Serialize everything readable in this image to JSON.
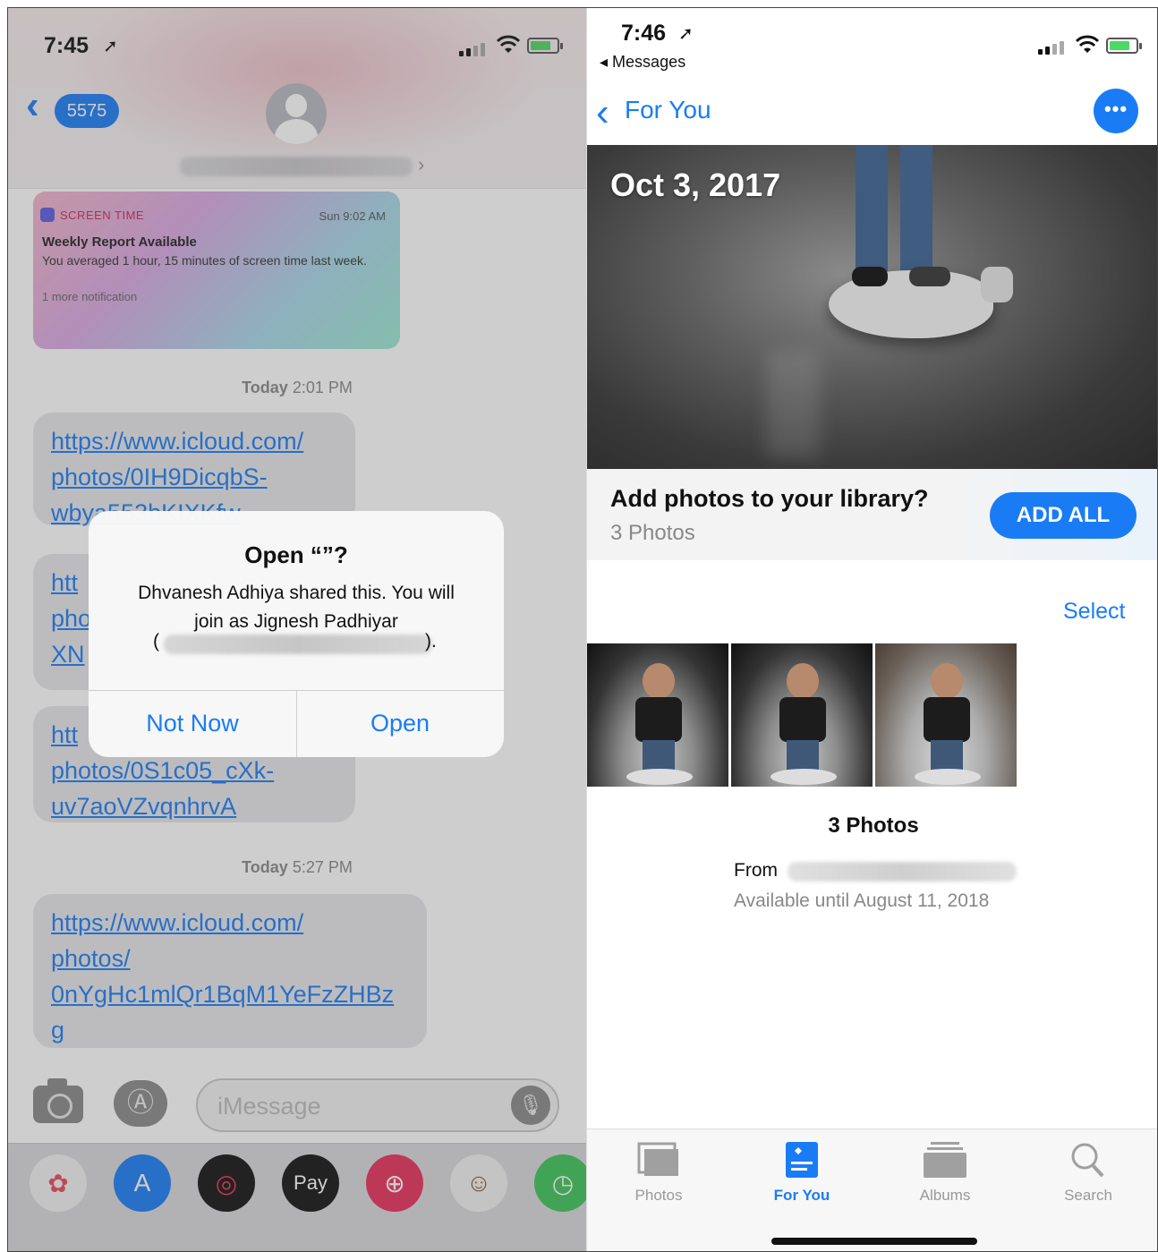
{
  "left": {
    "status_time": "7:45",
    "back_count": "5575",
    "notification": {
      "app": "SCREEN TIME",
      "time": "Sun 9:02 AM",
      "title": "Weekly Report Available",
      "body": "You averaged 1 hour, 15 minutes of screen time last week.",
      "more": "1 more notification"
    },
    "timestamp1_day": "Today",
    "timestamp1_time": "2:01 PM",
    "bubble1": [
      "https://www.icloud.com/",
      "photos/0IH9DicqbS-",
      "wbya553bKIXKfw"
    ],
    "bubble2": [
      "htt",
      "pho",
      "XN"
    ],
    "bubble3": [
      "htt",
      "photos/0S1c05_cXk-",
      "uv7aoVZvqnhrvA"
    ],
    "timestamp2_day": "Today",
    "timestamp2_time": "5:27 PM",
    "bubble4": [
      "https://www.icloud.com/",
      "photos/",
      "0nYgHc1mlQr1BqM1YeFzZHBz",
      "g"
    ],
    "alert": {
      "title": "Open “”?",
      "message_line1": "Dhvanesh Adhiya shared this. You will",
      "message_line2": "join as Jignesh Padhiyar",
      "paren_open": "(",
      "paren_close": ").",
      "not_now": "Not Now",
      "open": "Open"
    },
    "imessage_placeholder": "iMessage",
    "drawer_apps": [
      "Photos",
      "App Store",
      "Fitness",
      "Apple Pay",
      "Search Images",
      "Animoji",
      "Clock"
    ],
    "apple_pay_label": "Pay"
  },
  "right": {
    "status_time": "7:46",
    "back_app": "Messages",
    "nav_title": "For You",
    "hero_date": "Oct 3, 2017",
    "add_question": "Add photos to your library?",
    "add_count": "3 Photos",
    "add_all": "ADD ALL",
    "select": "Select",
    "photos_title": "3 Photos",
    "from_label": "From",
    "available": "Available until August 11, 2018",
    "tabs": [
      {
        "label": "Photos",
        "icon": "photos-tab-icon"
      },
      {
        "label": "For You",
        "icon": "for-you-tab-icon",
        "active": true
      },
      {
        "label": "Albums",
        "icon": "albums-tab-icon"
      },
      {
        "label": "Search",
        "icon": "search-tab-icon"
      }
    ]
  },
  "colors": {
    "ios_blue": "#1a7cf5",
    "bubble_gray": "#e6e6e9",
    "tab_inactive": "#999999"
  }
}
